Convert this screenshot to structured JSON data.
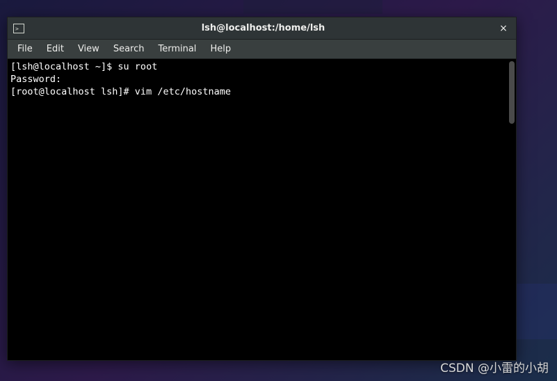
{
  "titlebar": {
    "title": "lsh@localhost:/home/lsh",
    "close": "×"
  },
  "menubar": {
    "items": [
      "File",
      "Edit",
      "View",
      "Search",
      "Terminal",
      "Help"
    ]
  },
  "terminal": {
    "lines": [
      "[lsh@localhost ~]$ su root",
      "Password:",
      "[root@localhost lsh]# vim /etc/hostname"
    ]
  },
  "watermark": "CSDN @小雷的小胡"
}
